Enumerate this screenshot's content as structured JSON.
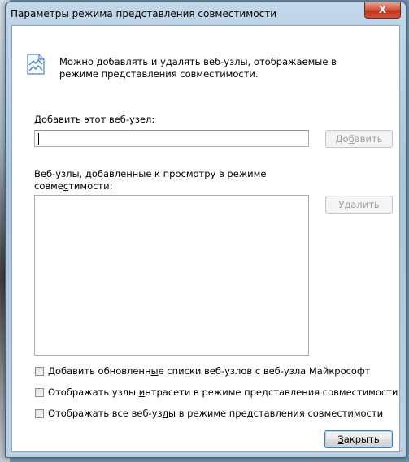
{
  "window": {
    "title": "Параметры режима представления совместимости",
    "close_glyph": "X"
  },
  "info": {
    "icon": "compatibility-view-icon",
    "text": "Можно добавлять и удалять веб-узлы, отображаемые в режиме представления совместимости."
  },
  "add_site": {
    "label_pre": "",
    "label_key": "Д",
    "label_post": "обавить этот веб-узел:",
    "input_value": "",
    "add_button_pre": "До",
    "add_button_key": "б",
    "add_button_post": "авить"
  },
  "sites_list": {
    "label_line1": "Веб-узлы, добавленные к просмотру в режиме",
    "label_line2_pre": "совме",
    "label_line2_key": "с",
    "label_line2_post": "тимости:",
    "items": [],
    "remove_button_pre": "",
    "remove_button_key": "У",
    "remove_button_post": "далить"
  },
  "options": [
    {
      "pre": "Добавить обновленн",
      "key": "ы",
      "post": "е списки веб-узлов с веб-узла Майкрософт",
      "checked": false
    },
    {
      "pre": "Отображать узлы ",
      "key": "и",
      "post": "нтрасети в режиме представления совместимости",
      "checked": false
    },
    {
      "pre": "Отображать все веб-уз",
      "key": "л",
      "post": "ы в режиме представления совместимости",
      "checked": false
    }
  ],
  "close_button": {
    "pre": "",
    "key": "З",
    "post": "акрыть"
  }
}
